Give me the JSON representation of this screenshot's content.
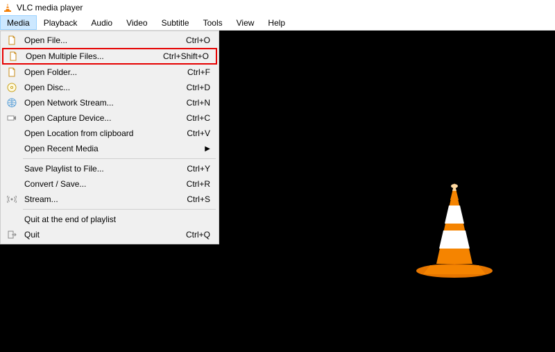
{
  "title": "VLC media player",
  "menubar": [
    "Media",
    "Playback",
    "Audio",
    "Video",
    "Subtitle",
    "Tools",
    "View",
    "Help"
  ],
  "active_menu_index": 0,
  "dropdown": {
    "groups": [
      [
        {
          "icon": "doc",
          "label": "Open File...",
          "shortcut": "Ctrl+O"
        },
        {
          "icon": "doc",
          "label": "Open Multiple Files...",
          "shortcut": "Ctrl+Shift+O",
          "highlighted": true
        },
        {
          "icon": "doc",
          "label": "Open Folder...",
          "shortcut": "Ctrl+F"
        },
        {
          "icon": "disc",
          "label": "Open Disc...",
          "shortcut": "Ctrl+D"
        },
        {
          "icon": "net",
          "label": "Open Network Stream...",
          "shortcut": "Ctrl+N"
        },
        {
          "icon": "cap",
          "label": "Open Capture Device...",
          "shortcut": "Ctrl+C"
        },
        {
          "icon": "",
          "label": "Open Location from clipboard",
          "shortcut": "Ctrl+V"
        },
        {
          "icon": "",
          "label": "Open Recent Media",
          "shortcut": "",
          "submenu": true
        }
      ],
      [
        {
          "icon": "",
          "label": "Save Playlist to File...",
          "shortcut": "Ctrl+Y"
        },
        {
          "icon": "",
          "label": "Convert / Save...",
          "shortcut": "Ctrl+R"
        },
        {
          "icon": "stream",
          "label": "Stream...",
          "shortcut": "Ctrl+S"
        }
      ],
      [
        {
          "icon": "",
          "label": "Quit at the end of playlist",
          "shortcut": ""
        },
        {
          "icon": "quit",
          "label": "Quit",
          "shortcut": "Ctrl+Q"
        }
      ]
    ]
  }
}
